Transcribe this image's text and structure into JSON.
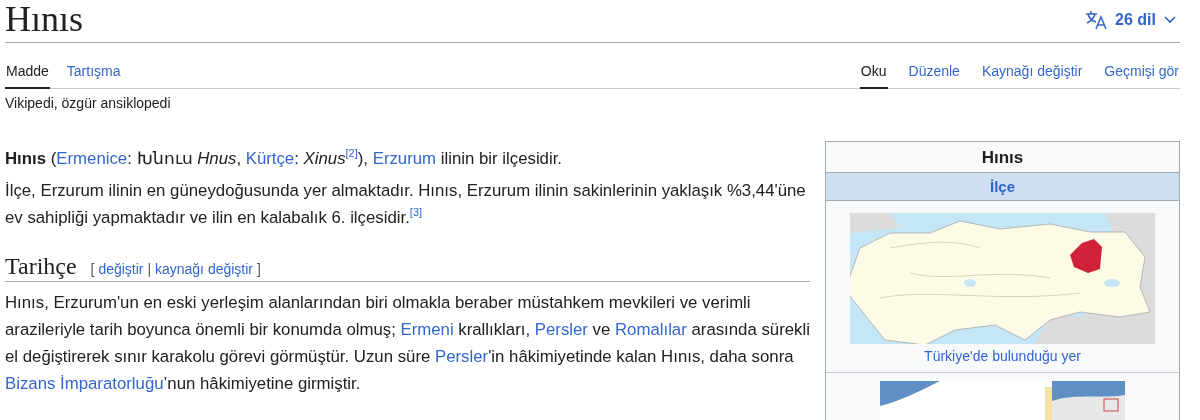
{
  "page_title": "Hınıs",
  "language_button": {
    "label": "26 dil"
  },
  "namespace_tabs": [
    {
      "label": "Madde",
      "selected": true
    },
    {
      "label": "Tartışma",
      "selected": false
    }
  ],
  "view_tabs": [
    {
      "label": "Oku",
      "selected": true
    },
    {
      "label": "Düzenle",
      "selected": false
    },
    {
      "label": "Kaynağı değiştir",
      "selected": false
    },
    {
      "label": "Geçmişi gör",
      "selected": false
    }
  ],
  "tagline": "Vikipedi, özgür ansiklopedi",
  "intro": [
    [
      {
        "kind": "bold",
        "text": "Hınıs"
      },
      {
        "kind": "plain",
        "text": " ("
      },
      {
        "kind": "link",
        "text": "Ermenice"
      },
      {
        "kind": "plain",
        "text": ": Խնուս "
      },
      {
        "kind": "italic",
        "text": "Hnus"
      },
      {
        "kind": "plain",
        "text": ", "
      },
      {
        "kind": "link",
        "text": "Kürtçe"
      },
      {
        "kind": "plain",
        "text": ": "
      },
      {
        "kind": "italic",
        "text": "Xinus"
      },
      {
        "kind": "ref",
        "text": "[2]"
      },
      {
        "kind": "plain",
        "text": "), "
      },
      {
        "kind": "link",
        "text": "Erzurum"
      },
      {
        "kind": "plain",
        "text": " ilinin bir ilçesidir."
      }
    ],
    [
      {
        "kind": "plain",
        "text": "İlçe, Erzurum ilinin en güneydoğusunda yer almaktadır. Hınıs, Erzurum ilinin sakinlerinin yaklaşık %3,44'üne ev sahipliği yapmaktadır ve ilin en kalabalık 6. ilçesidir."
      },
      {
        "kind": "ref",
        "text": "[3]"
      }
    ]
  ],
  "section": {
    "heading": "Tarihçe",
    "edit_brackets": {
      "open": "[",
      "separator": "|",
      "close": "]"
    },
    "edit_links": [
      {
        "text": "değiştir"
      },
      {
        "text": "kaynağı değiştir"
      }
    ],
    "paragraphs": [
      [
        {
          "kind": "plain",
          "text": "Hınıs, Erzurum'un en eski yerleşim alanlarından biri olmakla beraber müstahkem mevkileri ve verimli arazileriyle tarih boyunca önemli bir konumda olmuş; "
        },
        {
          "kind": "link",
          "text": "Ermeni"
        },
        {
          "kind": "plain",
          "text": " krallıkları, "
        },
        {
          "kind": "link",
          "text": "Persler"
        },
        {
          "kind": "plain",
          "text": " ve "
        },
        {
          "kind": "link",
          "text": "Romalılar"
        },
        {
          "kind": "plain",
          "text": " arasında sürekli el değiştirerek sınır karakolu görevi görmüştür. Uzun süre "
        },
        {
          "kind": "link",
          "text": "Persler"
        },
        {
          "kind": "plain",
          "text": "'in hâkimiyetinde kalan Hınıs, daha sonra "
        },
        {
          "kind": "link",
          "text": "Bizans İmparatorluğu"
        },
        {
          "kind": "plain",
          "text": "’nun hâkimiyetine girmiştir."
        }
      ]
    ]
  },
  "infobox": {
    "title": "Hınıs",
    "subtitle": "İlçe",
    "images": [
      {
        "kind": "picture",
        "caption": "Türkiye'de bulunduğu yer"
      },
      {
        "kind": "picture"
      }
    ]
  }
}
